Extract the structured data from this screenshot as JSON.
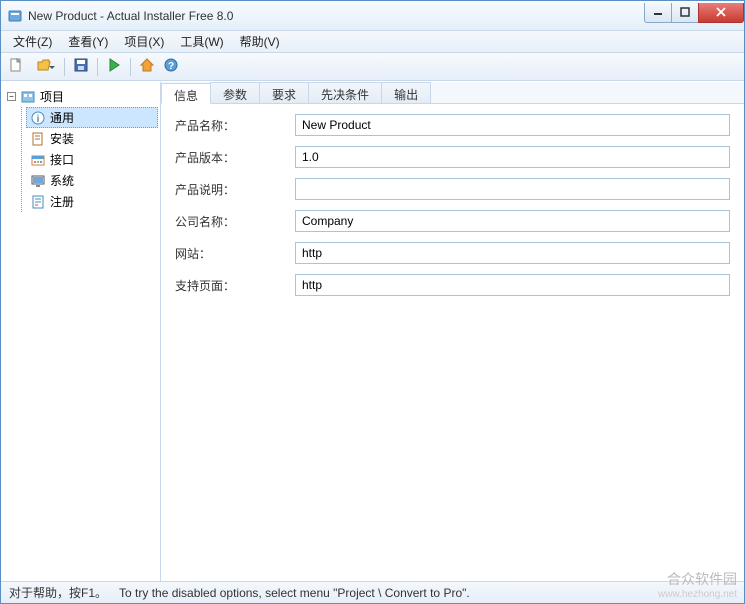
{
  "window": {
    "title": "New Product - Actual Installer Free 8.0"
  },
  "menu": {
    "file": "文件(Z)",
    "view": "查看(Y)",
    "project": "项目(X)",
    "tools": "工具(W)",
    "help": "帮助(V)"
  },
  "sidebar": {
    "root": "项目",
    "items": [
      {
        "label": "通用",
        "icon": "info"
      },
      {
        "label": "安装",
        "icon": "page"
      },
      {
        "label": "接口",
        "icon": "grid"
      },
      {
        "label": "系统",
        "icon": "monitor"
      },
      {
        "label": "注册",
        "icon": "form"
      }
    ]
  },
  "tabs": {
    "info": "信息",
    "params": "参数",
    "require": "要求",
    "prereq": "先决条件",
    "output": "输出"
  },
  "form": {
    "product_name_label": "产品名称：",
    "product_name": "New Product",
    "product_version_label": "产品版本：",
    "product_version": "1.0",
    "product_desc_label": "产品说明：",
    "product_desc": "",
    "company_label": "公司名称：",
    "company": "Company",
    "website_label": "网站：",
    "website": "http",
    "support_label": "支持页面：",
    "support": "http"
  },
  "status": {
    "help": "对于帮助，按F1。",
    "tip": "To try the disabled options, select menu \"Project \\ Convert to Pro\"."
  },
  "watermark": {
    "line1": "合众软件园",
    "line2": "www.hezhong.net"
  }
}
